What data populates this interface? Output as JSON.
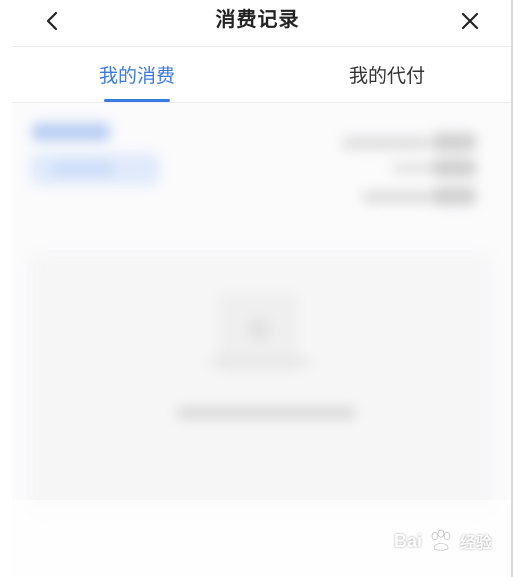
{
  "header": {
    "title": "消费记录",
    "back_icon": "chevron-left-icon",
    "close_icon": "close-icon"
  },
  "tabs": [
    {
      "label": "我的消费",
      "active": true
    },
    {
      "label": "我的代付",
      "active": false
    }
  ],
  "colors": {
    "accent": "#3a7be0",
    "text_primary": "#222222",
    "text_secondary": "#333333",
    "divider": "#ececec"
  },
  "watermark": {
    "brand": "Bai",
    "suffix": "经验",
    "icon": "baidu-paw-icon"
  }
}
